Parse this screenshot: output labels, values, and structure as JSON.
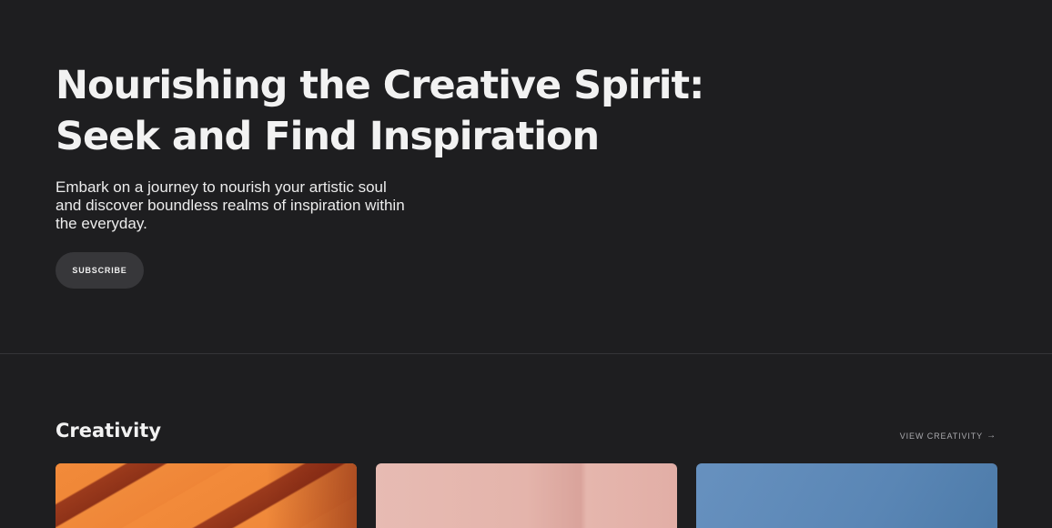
{
  "hero": {
    "title_line1": "Nourishing the Creative Spirit:",
    "title_line2": "Seek and Find Inspiration",
    "subtitle": "Embark on a journey to nourish your artistic soul and discover boundless realms of inspiration within the everyday.",
    "subscribe_label": "SUBSCRIBE"
  },
  "section": {
    "title": "Creativity",
    "view_link_label": "VIEW CREATIVITY",
    "view_link_icon": "arrow-right-icon",
    "cards": [
      {
        "image": "orange-shadow-stripes",
        "color": "#f08838"
      },
      {
        "image": "pink-folded-paper",
        "color": "#e4b4ab"
      },
      {
        "image": "blue-gradient",
        "color": "#5a86b5"
      }
    ]
  },
  "colors": {
    "background": "#1e1e20",
    "button_bg": "#37373a",
    "text": "#f2f2f2",
    "muted_text": "#a9a9ad",
    "divider": "#343437"
  }
}
